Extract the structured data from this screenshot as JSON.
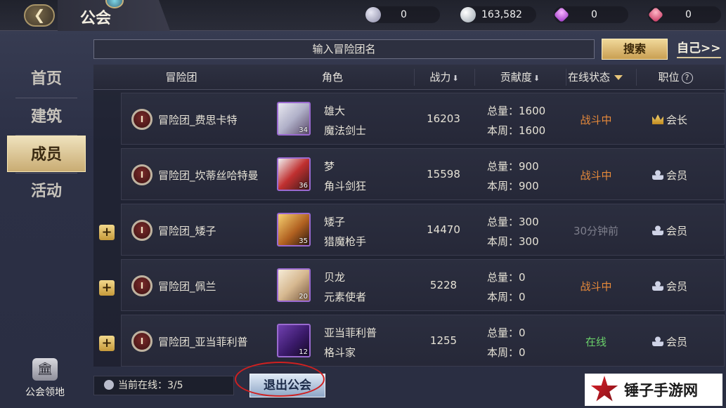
{
  "header": {
    "title": "公会",
    "currencies": [
      {
        "icon": "silver-coin-icon",
        "value": "0"
      },
      {
        "icon": "coin-icon",
        "value": "163,582"
      },
      {
        "icon": "purple-gem-icon",
        "value": "0"
      },
      {
        "icon": "red-gem-icon",
        "value": "0"
      }
    ]
  },
  "sidebar": {
    "items": [
      {
        "label": "首页",
        "active": false
      },
      {
        "label": "建筑",
        "active": false
      },
      {
        "label": "成员",
        "active": true
      },
      {
        "label": "活动",
        "active": false
      }
    ],
    "territory_label": "公会领地"
  },
  "search": {
    "placeholder": "输入冒险团名",
    "button_label": "搜索",
    "self_link": "自己>>"
  },
  "table": {
    "columns": {
      "team": "冒险团",
      "character": "角色",
      "power": "战力",
      "contribution": "贡献度",
      "status": "在线状态",
      "position": "职位"
    },
    "rows": [
      {
        "team": "冒险团_费思卡特",
        "name": "雄大",
        "class": "魔法剑士",
        "level": "34",
        "power": "16203",
        "total": "总量：1600",
        "week": "本周：1600",
        "status": "战斗中",
        "status_type": "fight",
        "role": "会长",
        "role_icon": "crown-icon",
        "has_add": false
      },
      {
        "team": "冒险团_坎蒂丝哈特曼",
        "name": "梦",
        "class": "角斗剑狂",
        "level": "36",
        "power": "15598",
        "total": "总量：900",
        "week": "本周：900",
        "status": "战斗中",
        "status_type": "fight",
        "role": "会员",
        "role_icon": "member-icon",
        "has_add": false
      },
      {
        "team": "冒险团_矮子",
        "name": "矮子",
        "class": "猎魔枪手",
        "level": "35",
        "power": "14470",
        "total": "总量：300",
        "week": "本周：300",
        "status": "30分钟前",
        "status_type": "offline",
        "role": "会员",
        "role_icon": "member-icon",
        "has_add": true
      },
      {
        "team": "冒险团_佩兰",
        "name": "贝龙",
        "class": "元素使者",
        "level": "20",
        "power": "5228",
        "total": "总量：0",
        "week": "本周：0",
        "status": "战斗中",
        "status_type": "fight",
        "role": "会员",
        "role_icon": "member-icon",
        "has_add": true
      },
      {
        "team": "冒险团_亚当菲利普",
        "name": "亚当菲利普",
        "class": "格斗家",
        "level": "12",
        "power": "1255",
        "total": "总量：0",
        "week": "本周：0",
        "status": "在线",
        "status_type": "online",
        "role": "会员",
        "role_icon": "member-icon",
        "has_add": true
      }
    ]
  },
  "footer": {
    "online_count": "当前在线：3/5",
    "leave_button": "退出公会"
  },
  "watermark": "锤子手游网",
  "colors": {
    "status_fight": "#e88a3a",
    "status_offline": "#7e7f8c",
    "status_online": "#6ad06a",
    "accent_gold": "#c99f52"
  }
}
